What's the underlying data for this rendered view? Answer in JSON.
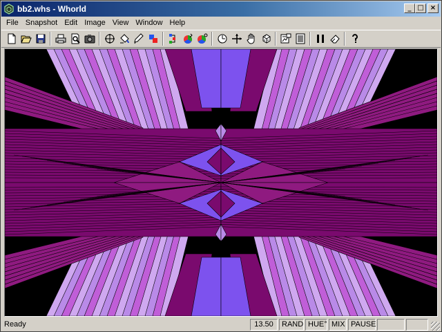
{
  "window": {
    "title": "bb2.whs - Whorld"
  },
  "titlebar_buttons": {
    "minimize": "_",
    "maximize": "□",
    "close": "×"
  },
  "menu": [
    "File",
    "Snapshot",
    "Edit",
    "Image",
    "View",
    "Window",
    "Help"
  ],
  "toolbar": [
    {
      "icon": "new-icon"
    },
    {
      "icon": "open-icon"
    },
    {
      "icon": "save-icon"
    },
    {
      "sep": true
    },
    {
      "icon": "print-icon"
    },
    {
      "icon": "print-preview-icon"
    },
    {
      "icon": "snapshot-camera-icon"
    },
    {
      "sep": true
    },
    {
      "icon": "move-origin-icon"
    },
    {
      "icon": "fill-icon"
    },
    {
      "icon": "pen-icon"
    },
    {
      "icon": "xray-icon"
    },
    {
      "sep": true
    },
    {
      "icon": "palette-icon"
    },
    {
      "icon": "color-wheel-icon"
    },
    {
      "icon": "mix-color-icon"
    },
    {
      "sep": true
    },
    {
      "icon": "zoom-icon"
    },
    {
      "icon": "crosshair-icon"
    },
    {
      "icon": "hand-icon"
    },
    {
      "icon": "random-icon"
    },
    {
      "sep": true
    },
    {
      "icon": "master-icon"
    },
    {
      "icon": "numbers-icon"
    },
    {
      "sep": true
    },
    {
      "icon": "pause-icon"
    },
    {
      "icon": "eraser-icon"
    },
    {
      "sep": true
    },
    {
      "icon": "help-icon"
    }
  ],
  "status": {
    "message": "Ready",
    "panes": [
      "13.50",
      "RAND",
      "HUE°",
      "MIX",
      "PAUSE",
      "",
      ""
    ]
  },
  "colors": {
    "deep": "#7a0a6e",
    "magenta": "#8f1a80",
    "violet": "#7d52ee",
    "lavender": "#b98ae8",
    "pink": "#c05ed8",
    "pale": "#cfa8f0"
  }
}
